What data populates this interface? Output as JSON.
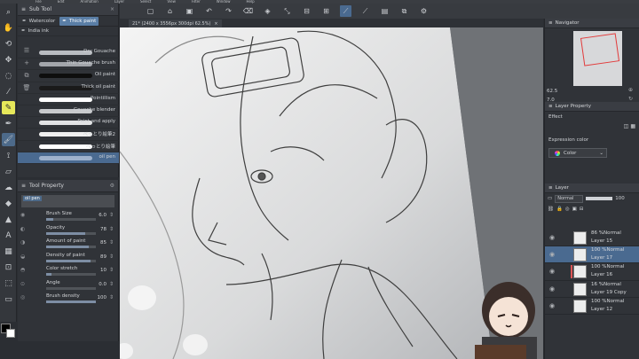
{
  "menu": [
    "File",
    "Edit",
    "Animation",
    "Layer",
    "Select",
    "View",
    "Filter",
    "Window",
    "Help"
  ],
  "command_icons": [
    "new-icon",
    "open-icon",
    "save-icon",
    "undo-icon",
    "redo-icon",
    "clear-icon",
    "fill-icon",
    "transform-icon",
    "deselect-icon",
    "invert-icon",
    "ruler-icon",
    "snap-icon",
    "grid-icon"
  ],
  "tools": [
    {
      "icon": "magnifier-icon",
      "glyph": "⌕"
    },
    {
      "icon": "hand-icon",
      "glyph": "✋"
    },
    {
      "icon": "rotate-icon",
      "glyph": "⟲"
    },
    {
      "icon": "move-icon",
      "glyph": "✥"
    },
    {
      "icon": "lasso-icon",
      "glyph": "◌"
    },
    {
      "icon": "eyedropper-icon",
      "glyph": "⁄"
    },
    {
      "icon": "pencil-tool-icon",
      "glyph": "✎",
      "active": true
    },
    {
      "icon": "pen-icon",
      "glyph": "✒"
    },
    {
      "icon": "brush-icon",
      "glyph": "🖌",
      "selected": true
    },
    {
      "icon": "airbrush-icon",
      "glyph": "⟟"
    },
    {
      "icon": "eraser-icon",
      "glyph": "▱"
    },
    {
      "icon": "blend-icon",
      "glyph": "☁"
    },
    {
      "icon": "fill-bucket-icon",
      "glyph": "◆"
    },
    {
      "icon": "figure-icon",
      "glyph": "▲"
    },
    {
      "icon": "text-icon",
      "glyph": "A"
    },
    {
      "icon": "gradient-icon",
      "glyph": "▦"
    },
    {
      "icon": "ruler-tool-icon",
      "glyph": "⊡"
    },
    {
      "icon": "select-icon",
      "glyph": "⬚"
    },
    {
      "icon": "frame-icon",
      "glyph": "▭"
    }
  ],
  "sub_tool": {
    "title": "Sub Tool",
    "tabs": [
      {
        "label": "Watercolor",
        "active": false
      },
      {
        "label": "Thick paint",
        "active": true
      }
    ],
    "group": "India ink",
    "brushes": [
      {
        "label": "Dry Gouache",
        "color": "#b9bcc1"
      },
      {
        "label": "Thin Gouache brush",
        "color": "#a3a6ab"
      },
      {
        "label": "Oil paint",
        "color": "#0e0e0e"
      },
      {
        "label": "Thick oil paint",
        "color": "#1a1a1a"
      },
      {
        "label": "Pointillism",
        "color": "#ffffff"
      },
      {
        "label": "Gouache blender",
        "color": "#c8cacd"
      },
      {
        "label": "Paint and apply",
        "color": "#e2e3e5"
      },
      {
        "label": "べっとり絵筆2",
        "color": "#f0f0f0"
      },
      {
        "label": "べっとり絵筆",
        "color": "#ffffff"
      },
      {
        "label": "oil pen",
        "color": "#9fb2cc",
        "selected": true
      }
    ]
  },
  "tool_property": {
    "title": "Tool Property",
    "preset_tag": "oil pen",
    "props": [
      {
        "name": "Brush Size",
        "value": "6.0",
        "fill": 0.15
      },
      {
        "name": "Opacity",
        "value": "78",
        "fill": 0.78
      },
      {
        "name": "Amount of paint",
        "value": "85",
        "fill": 0.85
      },
      {
        "name": "Density of paint",
        "value": "89",
        "fill": 0.89
      },
      {
        "name": "Color stretch",
        "value": "10",
        "fill": 0.1
      },
      {
        "name": "Angle",
        "value": "0.0",
        "fill": 0.0
      },
      {
        "name": "Brush density",
        "value": "100",
        "fill": 1.0
      }
    ]
  },
  "canvas": {
    "tab_label": "21* (2400 x 3556px 300dpi 62.5%)"
  },
  "navigator": {
    "title": "Navigator",
    "zoom": "62.5",
    "rotation": "7.0"
  },
  "layer_property": {
    "title": "Layer Property",
    "effect_label": "Effect",
    "expression_label": "Expression color",
    "expression_value": "Color"
  },
  "layer_panel": {
    "title": "Layer",
    "blend_mode": "Normal",
    "opacity": "100",
    "layers": [
      {
        "mode": "86 %Normal",
        "name": "Layer 15",
        "selected": false
      },
      {
        "mode": "100 %Normal",
        "name": "Layer 17",
        "selected": true
      },
      {
        "mode": "100 %Normal",
        "name": "Layer 16",
        "selected": false,
        "clip": true
      },
      {
        "mode": "16 %Normal",
        "name": "Layer 19 Copy",
        "selected": false
      },
      {
        "mode": "100 %Normal",
        "name": "Layer 12",
        "selected": false
      }
    ]
  }
}
